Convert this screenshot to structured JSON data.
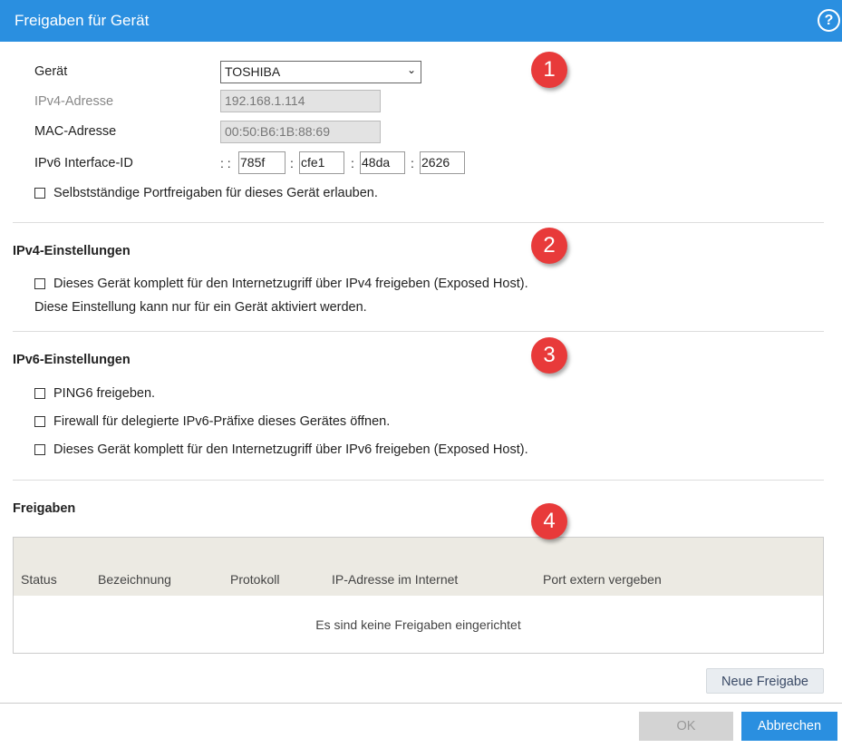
{
  "header": {
    "title": "Freigaben für Gerät",
    "help_icon": "?"
  },
  "device": {
    "geraet_label": "Gerät",
    "geraet_value": "TOSHIBA",
    "ipv4_label": "IPv4-Adresse",
    "ipv4_value": "192.168.1.114",
    "mac_label": "MAC-Adresse",
    "mac_value": "00:50:B6:1B:88:69",
    "ipv6_label": "IPv6 Interface-ID",
    "ipv6_prefix": ": :",
    "ipv6_sep": ":",
    "ipv6_parts": [
      "785f",
      "cfe1",
      "48da",
      "2626"
    ],
    "allow_label": "Selbstständige Portfreigaben für dieses Gerät erlauben."
  },
  "ipv4": {
    "title": "IPv4-Einstellungen",
    "exposed_label": "Dieses Gerät komplett für den Internetzugriff über IPv4 freigeben (Exposed Host).",
    "note": "Diese Einstellung kann nur für ein Gerät aktiviert werden."
  },
  "ipv6": {
    "title": "IPv6-Einstellungen",
    "options": [
      "PING6 freigeben.",
      "Firewall für delegierte IPv6-Präfixe dieses Gerätes öffnen.",
      "Dieses Gerät komplett für den Internetzugriff über IPv6 freigeben (Exposed Host)."
    ]
  },
  "freigaben": {
    "title": "Freigaben",
    "columns": [
      "Status",
      "Bezeichnung",
      "Protokoll",
      "IP-Adresse im Internet",
      "Port extern vergeben"
    ],
    "empty": "Es sind keine Freigaben eingerichtet",
    "new_button": "Neue Freigabe"
  },
  "badges": [
    "1",
    "2",
    "3",
    "4"
  ],
  "footer": {
    "ok": "OK",
    "cancel": "Abbrechen"
  },
  "colors": {
    "accent": "#2a8fe0",
    "badge": "#e83a3a"
  }
}
